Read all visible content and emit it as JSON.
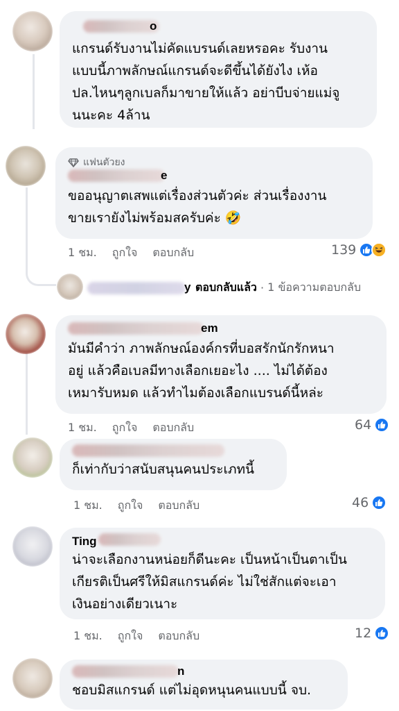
{
  "comments": [
    {
      "name": "",
      "name_tail": "o",
      "body": "แกรนด์รับงานไม่คัดแบรนด์เลยหรอคะ รับงาน\nแบบนี้ภาพลักษณ์แกรนด์จะดีขึ้นได้ยังไง เห้อ\nปล.ไหนๆลูกเบลก็มาขายให้แล้ว อย่าบีบจ่ายแม่จู\nนนะคะ 4ล้าน"
    },
    {
      "badge": "แฟนตัวยง",
      "name": "",
      "name_tail": "e",
      "body": "ขออนุญาตเสพแต่เรื่องส่วนตัวค่ะ ส่วนเรื่องงาน\nขายเรายังไม่พร้อมสครับค่ะ 🤣",
      "time": "1 ชม.",
      "like": "ถูกใจ",
      "reply": "ตอบกลับ",
      "count": "139"
    },
    {
      "name": "",
      "name_tail": "em",
      "body": "มันมีคำว่า ภาพลักษณ์องค์กรที่บอสรักนักรักหนา\nอยู่ แล้วคือเบลมีทางเลือกเยอะไง .... ไม่ได้ต้อง\nเหมารับหมด แล้วทำไมต้องเลือกแบรนด์นี้หล่ะ",
      "time": "1 ชม.",
      "like": "ถูกใจ",
      "reply": "ตอบกลับ",
      "count": "64"
    },
    {
      "name": "",
      "name_tail": "",
      "body": "ก็เท่ากับว่าสนับสนุนคนประเภทนี้",
      "time": "1 ชม.",
      "like": "ถูกใจ",
      "reply": "ตอบกลับ",
      "count": "46"
    },
    {
      "name": "Ting",
      "name_tail": "",
      "body": "น่าจะเลือกงานหน่อยก็ดีนะคะ เป็นหน้าเป็นตาเป็น\nเกียรติเป็นศรีให้มิสแกรนด์ค่ะ ไม่ใช่สักแต่จะเอา\nเงินอย่างเดียวเนาะ",
      "time": "1 ชม.",
      "like": "ถูกใจ",
      "reply": "ตอบกลับ",
      "count": "12"
    },
    {
      "name": "",
      "name_tail": "n",
      "body": "ชอบมิสแกรนด์ แต่ไม่อุดหนุนคนแบบนี้ จบ."
    }
  ],
  "reply_summary": {
    "tail": "y",
    "replied": "ตอบกลับแล้ว",
    "dot": " · ",
    "count_text": "1 ข้อความตอบกลับ"
  },
  "colors": {
    "bubble": "#f0f2f5",
    "secondary_text": "#65676b",
    "like_blue": "#1877f2",
    "haha_yellow": "#f7b125"
  }
}
